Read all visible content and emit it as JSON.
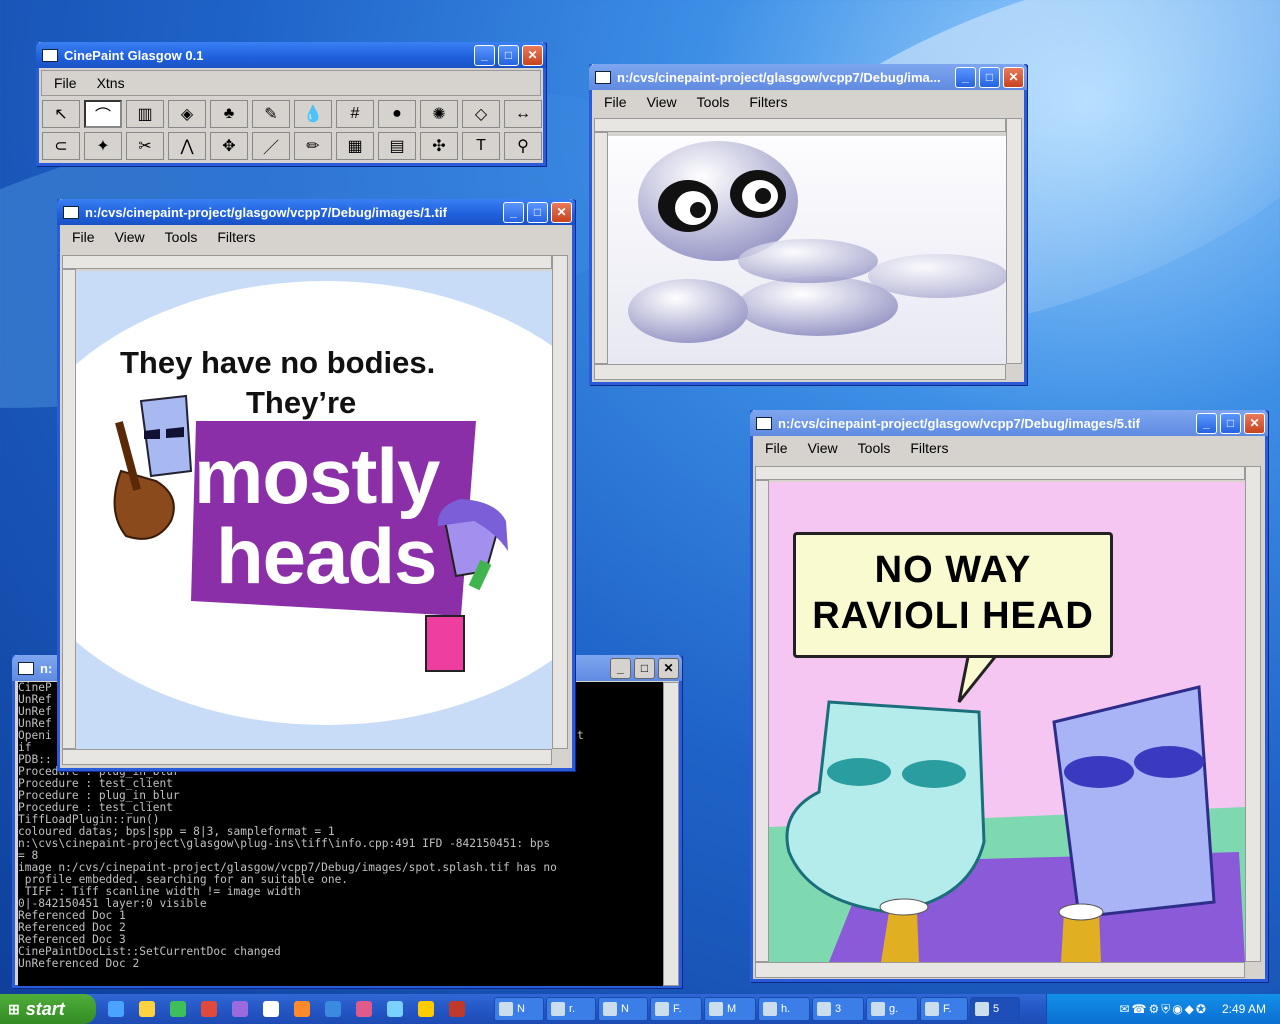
{
  "toolbox": {
    "title": "CinePaint Glasgow 0.1",
    "menu": [
      "File",
      "Xtns"
    ],
    "tools_row1": [
      "↖",
      "⌒",
      "▥",
      "◈",
      "♣",
      "✎",
      "💧",
      "#",
      "●",
      "✺",
      "◇",
      "↔"
    ],
    "tools_row2": [
      "⊂",
      "✦",
      "✂",
      "⋀",
      "✥",
      "／",
      "✏",
      "▦",
      "▤",
      "✣",
      "T",
      "⚲"
    ]
  },
  "win_spot": {
    "title": "n:/cvs/cinepaint-project/glasgow/vcpp7/Debug/ima...",
    "menu": [
      "File",
      "View",
      "Tools",
      "Filters"
    ]
  },
  "win_1": {
    "title": "n:/cvs/cinepaint-project/glasgow/vcpp7/Debug/images/1.tif",
    "menu": [
      "File",
      "View",
      "Tools",
      "Filters"
    ],
    "line1": "They have no bodies.",
    "line2": "They’re",
    "big1": "mostly",
    "big2": "heads"
  },
  "win_5": {
    "title": "n:/cvs/cinepaint-project/glasgow/vcpp7/Debug/images/5.tif",
    "menu": [
      "File",
      "View",
      "Tools",
      "Filters"
    ],
    "bubble1": "NO WAY",
    "bubble2": "RAVIOLI HEAD"
  },
  "console": {
    "title": "n:",
    "lines": [
      "CineP",
      "UnRef",
      "UnRef",
      "UnRef",
      "Openi                                                                   pot.splash.t",
      "if",
      "PDB::",
      "Procedure : plug_in_blur",
      "Procedure : test_client",
      "Procedure : plug_in_blur",
      "Procedure : test_client",
      "TiffLoadPlugin::run()",
      "coloured datas; bps|spp = 8|3, sampleformat = 1",
      "n:\\cvs\\cinepaint-project\\glasgow\\plug-ins\\tiff\\info.cpp:491 IFD -842150451: bps",
      "= 8",
      "image n:/cvs/cinepaint-project/glasgow/vcpp7/Debug/images/spot.splash.tif has no",
      " profile embedded. searching for an suitable one.",
      " TIFF : Tiff scanline width != image width",
      "0|-842150451 layer:0 visible",
      "Referenced Doc 1",
      "Referenced Doc 2",
      "Referenced Doc 3",
      "CinePaintDocList::SetCurrentDoc changed",
      "UnReferenced Doc 2"
    ]
  },
  "taskbar": {
    "start": "start",
    "tasks": [
      "N",
      "r.",
      "N",
      "F.",
      "M",
      "h.",
      "3",
      "g.",
      "F.",
      "5"
    ],
    "clock": "2:49 AM"
  },
  "colors": {
    "titlebar": "#1f5fdc",
    "purple": "#8b2fa8",
    "pink_bg": "#f6c6f2",
    "lightblue_bg": "#c8dcf8"
  }
}
